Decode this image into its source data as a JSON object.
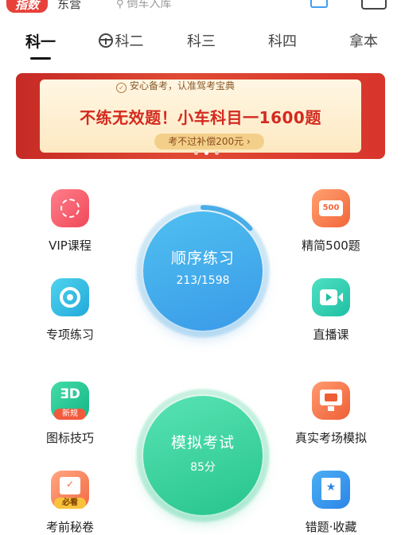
{
  "header": {
    "logo_text": "指数",
    "city": "东营",
    "search_placeholder": "倒车入库"
  },
  "tabs": [
    {
      "label": "科一",
      "active": true
    },
    {
      "label": "科二",
      "active": false
    },
    {
      "label": "科三",
      "active": false
    },
    {
      "label": "科四",
      "active": false
    },
    {
      "label": "拿本",
      "active": false
    }
  ],
  "banner": {
    "tag": "安心备考，认准驾考宝典",
    "title": "不练无效题！小车科目一1600题",
    "button": "考不过补偿200元 ›",
    "page_count": 3,
    "active_page": 1
  },
  "grid": {
    "vip": "VIP课程",
    "five_hundred": "精简500题",
    "five_hundred_badge": "500",
    "special": "专项练习",
    "live": "直播课",
    "tips": "图标技巧",
    "tips_icon_text": "ƎD",
    "tips_badge": "新规",
    "real_exam": "真实考场模拟",
    "secret": "考前秘卷",
    "secret_badge": "必看",
    "wrong": "错题·收藏"
  },
  "practice": {
    "title": "顺序练习",
    "progress": "213/1598",
    "done": 213,
    "total": 1598
  },
  "mock": {
    "title": "模拟考试",
    "score": "85分"
  },
  "colors": {
    "accent_red": "#e8413a",
    "practice_blue": "#3a9ae8",
    "mock_green": "#27c48d"
  }
}
